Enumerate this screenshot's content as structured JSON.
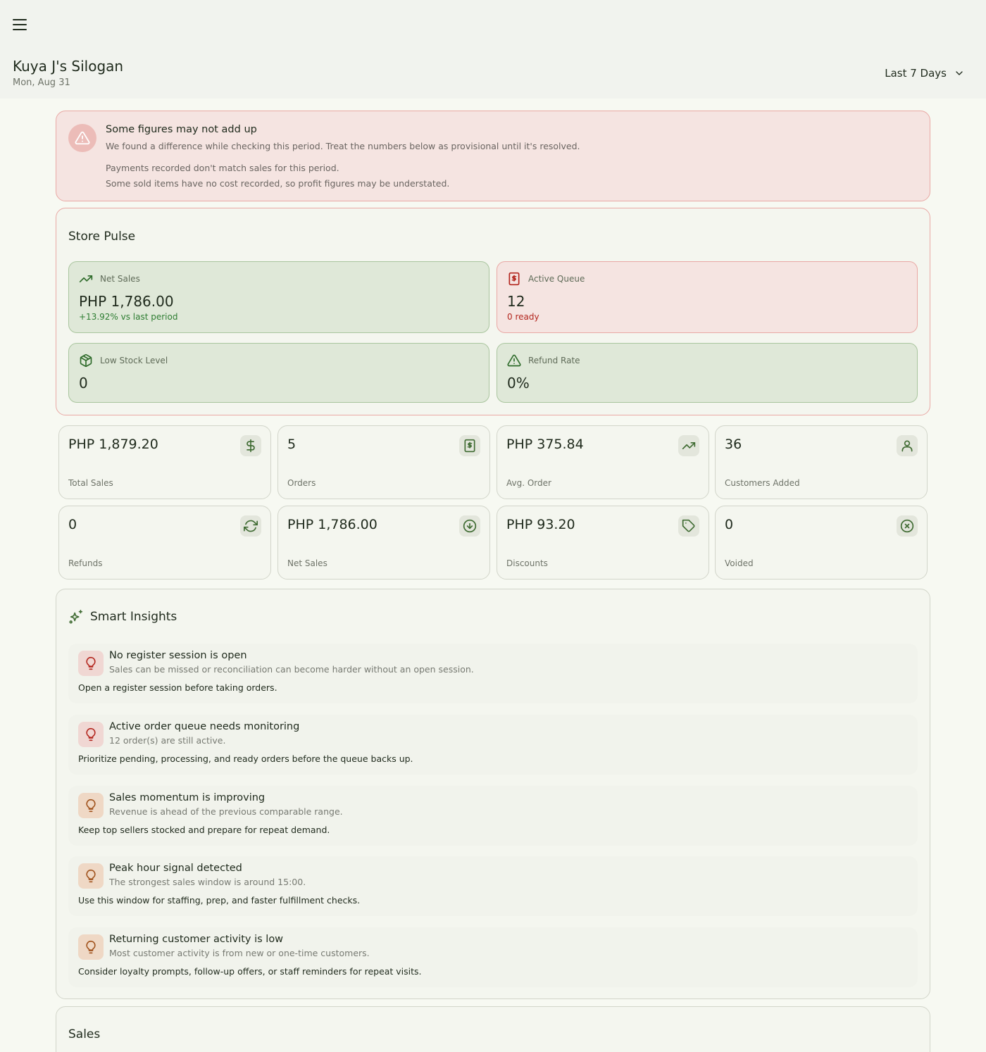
{
  "header": {
    "menu_icon": "hamburger-menu-icon",
    "store_name": "Kuya J's Silogan",
    "date": "Mon, Aug 31",
    "period_label": "Last 7 Days"
  },
  "alert": {
    "title": "Some figures may not add up",
    "message": "We found a difference while checking this period. Treat the numbers below as provisional until it's resolved.",
    "issues": [
      "Payments recorded don't match sales for this period.",
      "Some sold items have no cost recorded, so profit figures may be understated."
    ]
  },
  "pulse": {
    "title": "Store Pulse",
    "cards": [
      {
        "label": "Net Sales",
        "value": "PHP 1,786.00",
        "sub": "+13.92% vs last period",
        "icon": "trending-up-icon"
      },
      {
        "label": "Active Queue",
        "value": "12",
        "sub": "0 ready",
        "icon": "receipt-icon"
      },
      {
        "label": "Low Stock Level",
        "value": "0",
        "icon": "package-icon"
      },
      {
        "label": "Refund Rate",
        "value": "0%",
        "icon": "warning-triangle-icon"
      }
    ]
  },
  "stats": [
    {
      "value": "PHP 1,879.20",
      "label": "Total Sales",
      "icon": "dollar-icon"
    },
    {
      "value": "5",
      "label": "Orders",
      "icon": "receipt-icon"
    },
    {
      "value": "PHP 375.84",
      "label": "Avg. Order",
      "icon": "trending-up-icon"
    },
    {
      "value": "36",
      "label": "Customers Added",
      "icon": "user-icon"
    },
    {
      "value": "0",
      "label": "Refunds",
      "icon": "refresh-icon"
    },
    {
      "value": "PHP 1,786.00",
      "label": "Net Sales",
      "icon": "arrow-down-circle-icon"
    },
    {
      "value": "PHP 93.20",
      "label": "Discounts",
      "icon": "tag-icon"
    },
    {
      "value": "0",
      "label": "Voided",
      "icon": "x-circle-icon"
    }
  ],
  "insights": {
    "title": "Smart Insights",
    "items": [
      {
        "title": "No register session is open",
        "detail": "Sales can be missed or reconciliation can become harder without an open session.",
        "action": "Open a register session before taking orders.",
        "severity": "red"
      },
      {
        "title": "Active order queue needs monitoring",
        "detail": "12 order(s) are still active.",
        "action": "Prioritize pending, processing, and ready orders before the queue backs up.",
        "severity": "red"
      },
      {
        "title": "Sales momentum is improving",
        "detail": "Revenue is ahead of the previous comparable range.",
        "action": "Keep top sellers stocked and prepare for repeat demand.",
        "severity": "amber"
      },
      {
        "title": "Peak hour signal detected",
        "detail": "The strongest sales window is around 15:00.",
        "action": "Use this window for staffing, prep, and faster fulfillment checks.",
        "severity": "amber"
      },
      {
        "title": "Returning customer activity is low",
        "detail": "Most customer activity is from new or one-time customers.",
        "action": "Consider loyalty prompts, follow-up offers, or staff reminders for repeat visits.",
        "severity": "amber"
      }
    ]
  },
  "sales": {
    "title": "Sales"
  },
  "colors": {
    "positive": "#2e7d32",
    "negative": "#b3261e",
    "accent_green": "#3f6b32",
    "warning_amber": "#a0521c"
  }
}
